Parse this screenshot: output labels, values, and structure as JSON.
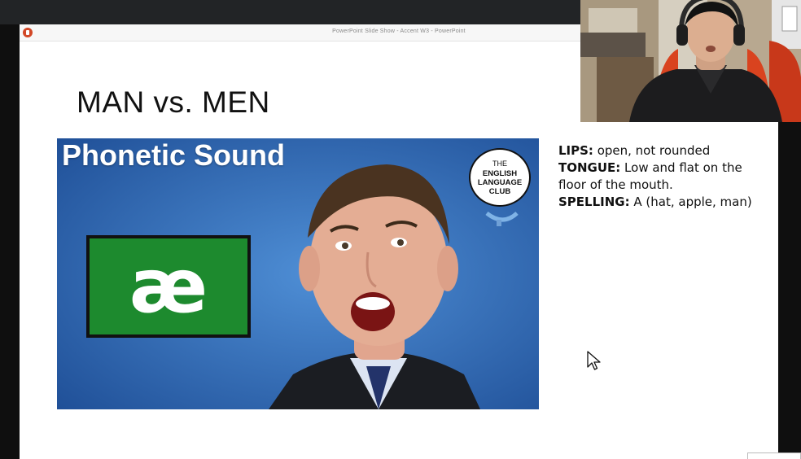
{
  "window": {
    "title": "PowerPoint Slide Show  -  Accent W3  -  PowerPoint"
  },
  "slide": {
    "title": "MAN vs. MEN",
    "thumbnail": {
      "heading": "Phonetic Sound",
      "symbol": "æ",
      "badge": {
        "line1": "THE",
        "line2": "ENGLISH",
        "line3": "LANGUAGE",
        "line4": "CLUB"
      }
    },
    "notes": [
      {
        "label": "LIPS:",
        "text": " open, not rounded"
      },
      {
        "label": "TONGUE:",
        "text": " Low and flat on the floor of the mouth."
      },
      {
        "label": "SPELLING:",
        "text": " A (hat, apple, man)"
      }
    ]
  },
  "icons": {
    "app": "powerpoint-icon",
    "cursor": "mouse-pointer-icon"
  },
  "colors": {
    "thumbnail_background": "#2f6ab6",
    "symbol_box": "#1d8a2e",
    "powerpoint_brand": "#d24726"
  }
}
